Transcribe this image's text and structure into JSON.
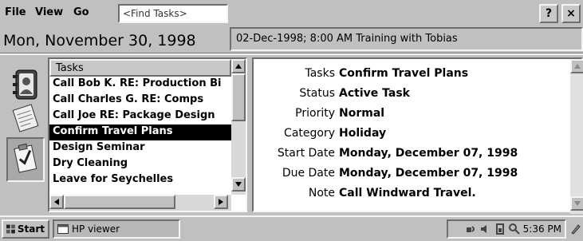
{
  "menubar": {
    "file": "File",
    "view": "View",
    "go": "Go",
    "find_placeholder": "<Find Tasks>",
    "help_label": "?",
    "close_label": "×"
  },
  "date_header": "Mon, November 30, 1998",
  "appointment_text": "02-Dec-1998;  8:00 AM  Training with Tobias",
  "task_list": {
    "header": "Tasks",
    "items": [
      "Call Bob K. RE: Production Bi",
      "Call Charles G. RE: Comps",
      "Call Joe RE: Package Design",
      "Confirm Travel Plans",
      "Design Seminar",
      "Dry Cleaning",
      "Leave for Seychelles"
    ],
    "selected_index": 3
  },
  "details": {
    "tasks_label": "Tasks",
    "tasks_value": "Confirm Travel Plans",
    "status_label": "Status",
    "status_value": "Active Task",
    "priority_label": "Priority",
    "priority_value": "Normal",
    "category_label": "Category",
    "category_value": "Holiday",
    "start_label": "Start Date",
    "start_value": "Monday, December 07, 1998",
    "due_label": "Due Date",
    "due_value": "Monday, December 07, 1998",
    "note_label": "Note",
    "note_value": "Call Windward Travel."
  },
  "taskbar": {
    "start_label": "Start",
    "app_label": "HP viewer",
    "clock": "5:36 PM"
  },
  "sidebar_icons": [
    "contacts-icon",
    "notes-icon",
    "tasks-icon"
  ],
  "colors": {
    "selection_bg": "#000000",
    "selection_fg": "#ffffff",
    "chrome": "#c0c0c0"
  }
}
